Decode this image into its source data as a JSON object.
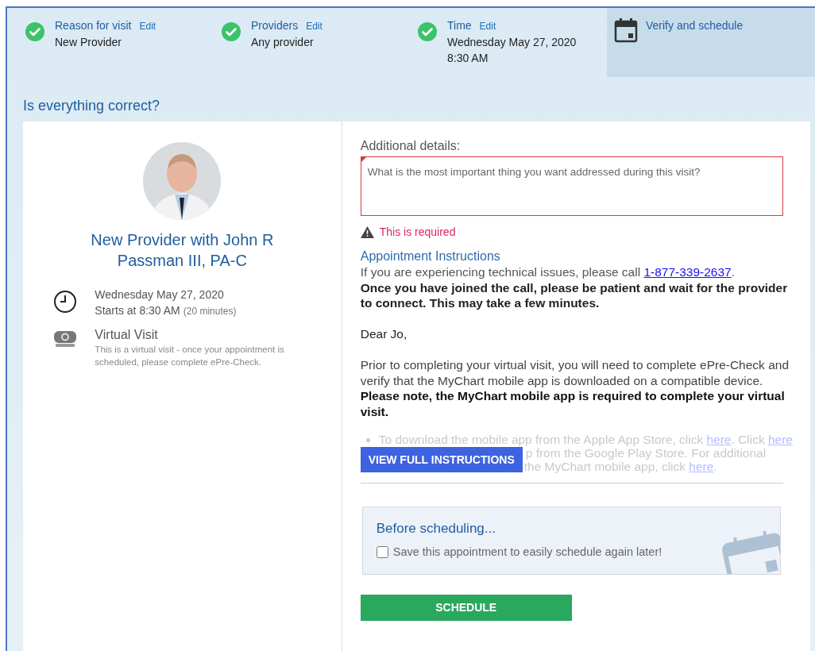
{
  "steps": [
    {
      "kind": "done",
      "label": "Reason for visit",
      "edit": "Edit",
      "values": [
        "New Provider"
      ]
    },
    {
      "kind": "done",
      "label": "Providers",
      "edit": "Edit",
      "values": [
        "Any provider"
      ]
    },
    {
      "kind": "done",
      "label": "Time",
      "edit": "Edit",
      "values": [
        "Wednesday May 27, 2020",
        "8:30 AM"
      ]
    },
    {
      "kind": "current",
      "label": "Verify and schedule"
    }
  ],
  "heading": "Is everything correct?",
  "provider": {
    "title": "New Provider with John R Passman III, PA-C",
    "date": "Wednesday May 27, 2020",
    "start": "Starts at 8:30 AM",
    "duration": "(20 minutes)",
    "visit_type": "Virtual Visit",
    "visit_note": "This is a virtual visit - once your appointment is scheduled, please complete ePre-Check."
  },
  "details": {
    "label": "Additional details:",
    "placeholder": "What is the most important thing you want addressed during this visit?",
    "error": "This is required"
  },
  "instructions": {
    "title": "Appointment Instructions",
    "tech_text": "If you are experiencing technical issues, please call ",
    "phone": "1-877-339-2637",
    "tech_end": ".",
    "notice": "Once you have joined the call, please be patient and wait for the provider to connect. This may take a few minutes.",
    "greeting": "Dear Jo,",
    "prior": "Prior to completing your virtual visit, you will need to complete ePre-Check and verify that the MyChart mobile app is downloaded on a compatible device. **Please note, the MyChart mobile app is required to complete your virtual visit.**",
    "bullet": {
      "line_1": "To download the mobile app from the Apple App Store, click ",
      "link_1": "here",
      "mid": ". Click ",
      "link_2": "here",
      "line_2": "p from the Google Play Store. For additional",
      "line_3": "the MyChart mobile app, click ",
      "link_3": "here",
      "end": "."
    },
    "button": "VIEW FULL INSTRUCTIONS"
  },
  "before": {
    "title": "Before scheduling...",
    "checkbox": {
      "label": "Save this appointment to easily schedule again later!",
      "checked": false
    }
  },
  "schedule_button": "SCHEDULE"
}
